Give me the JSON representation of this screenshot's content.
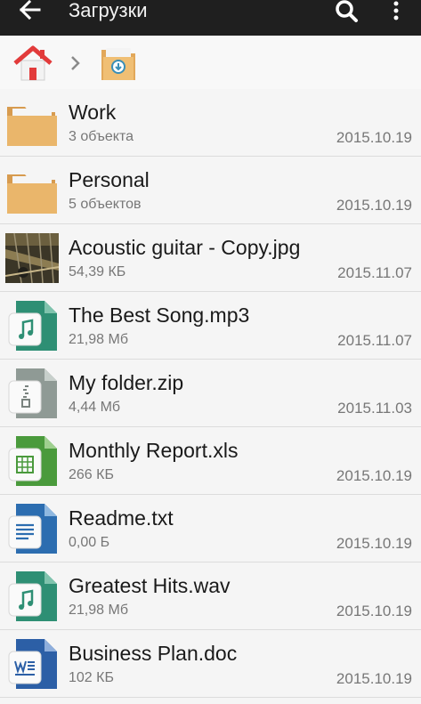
{
  "appbar": {
    "title": "Загрузки",
    "back_icon": "arrow-left-icon",
    "search_icon": "search-icon",
    "more_icon": "more-vertical-icon"
  },
  "breadcrumb": {
    "home_icon": "home-icon",
    "separator_icon": "chevron-right-icon",
    "current_icon": "downloads-folder-icon"
  },
  "files": [
    {
      "name": "Work",
      "meta": "3 объекта",
      "date": "2015.10.19",
      "icon": "folder-icon"
    },
    {
      "name": "Personal",
      "meta": "5 объектов",
      "date": "2015.10.19",
      "icon": "folder-icon"
    },
    {
      "name": "Acoustic guitar - Copy.jpg",
      "meta": "54,39 КБ",
      "date": "2015.11.07",
      "icon": "image-thumbnail"
    },
    {
      "name": "The Best Song.mp3",
      "meta": "21,98 Мб",
      "date": "2015.11.07",
      "icon": "music-file-icon"
    },
    {
      "name": "My folder.zip",
      "meta": "4,44 Мб",
      "date": "2015.11.03",
      "icon": "zip-file-icon"
    },
    {
      "name": "Monthly Report.xls",
      "meta": "266 КБ",
      "date": "2015.10.19",
      "icon": "spreadsheet-file-icon"
    },
    {
      "name": "Readme.txt",
      "meta": "0,00 Б",
      "date": "2015.10.19",
      "icon": "text-file-icon"
    },
    {
      "name": "Greatest Hits.wav",
      "meta": "21,98 Мб",
      "date": "2015.10.19",
      "icon": "music-file-icon"
    },
    {
      "name": "Business Plan.doc",
      "meta": "102 КБ",
      "date": "2015.10.19",
      "icon": "word-file-icon"
    }
  ],
  "colors": {
    "appbar": "#1f1f1f",
    "folder": "#e8b56a",
    "music": "#2e8f74",
    "zip": "#8f9a95",
    "xls": "#4a9a3c",
    "txt": "#2c6db0",
    "doc": "#2c5fa6"
  }
}
